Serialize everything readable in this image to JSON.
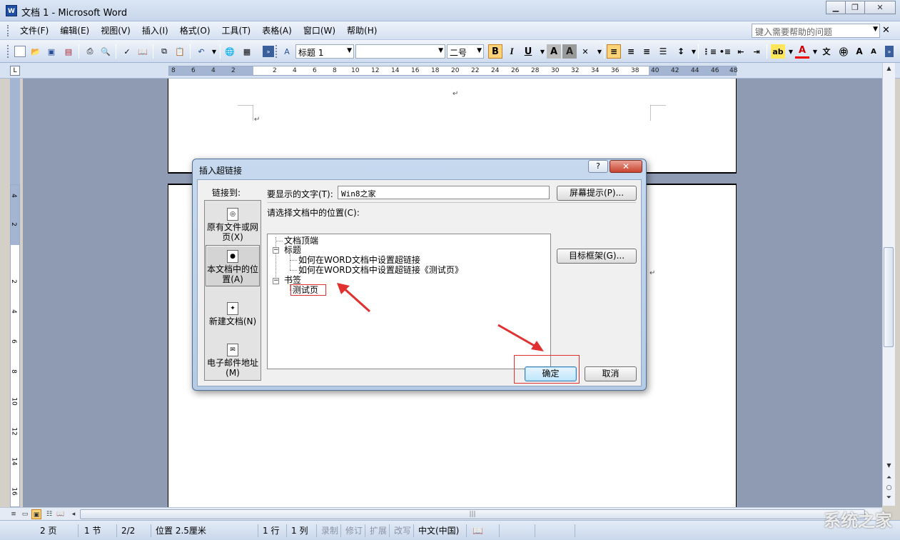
{
  "window": {
    "title": "文档 1 - Microsoft Word",
    "app_icon": "W"
  },
  "menu": {
    "items": [
      "文件(F)",
      "编辑(E)",
      "视图(V)",
      "插入(I)",
      "格式(O)",
      "工具(T)",
      "表格(A)",
      "窗口(W)",
      "帮助(H)"
    ],
    "help_placeholder": "键入需要帮助的问题"
  },
  "toolbar": {
    "style_combo": "标题 1",
    "font_combo": "",
    "size_combo": "二号",
    "bold": "B",
    "italic": "I",
    "underline": "U",
    "char_a": "A",
    "char_a2": "A"
  },
  "ruler": {
    "ticks": [
      "8",
      "6",
      "4",
      "2",
      "",
      "2",
      "4",
      "6",
      "8",
      "10",
      "12",
      "14",
      "16",
      "18",
      "20",
      "22",
      "24",
      "26",
      "28",
      "30",
      "32",
      "34",
      "36",
      "38",
      "40",
      "42",
      "44",
      "46",
      "48"
    ],
    "vticks": [
      "4",
      "2",
      "",
      "2",
      "4",
      "6",
      "8",
      "10",
      "12",
      "14",
      "16"
    ]
  },
  "document": {
    "pilcrow": "↵"
  },
  "dialog": {
    "title": "插入超链接",
    "help_btn": "?",
    "close_btn": "✕",
    "link_to": "链接到:",
    "places": [
      {
        "label": "原有文件或网页(X)",
        "icon": "globe-file-icon"
      },
      {
        "label": "本文档中的位置(A)",
        "icon": "document-place-icon",
        "active": true
      },
      {
        "label": "新建文档(N)",
        "icon": "new-document-icon"
      },
      {
        "label": "电子邮件地址(M)",
        "icon": "email-icon"
      }
    ],
    "display_text_label": "要显示的文字(T):",
    "display_text_value": "Win8之家",
    "screentip_btn": "屏幕提示(P)...",
    "select_place_label": "请选择文档中的位置(C):",
    "tree": {
      "top": "文档顶端",
      "headings": "标题",
      "heading_1": "如何在WORD文档中设置超链接",
      "heading_2": "如何在WORD文档中设置超链接《测试页》",
      "bookmarks": "书签",
      "bookmark_1": "测试页"
    },
    "target_frame_btn": "目标框架(G)...",
    "ok_btn": "确定",
    "cancel_btn": "取消"
  },
  "statusbar": {
    "page": "2 页",
    "section": "1 节",
    "pages": "2/2",
    "position": "位置 2.5厘米",
    "line": "1 行",
    "column": "1 列",
    "rec": "录制",
    "trk": "修订",
    "ext": "扩展",
    "ovr": "改写",
    "language": "中文(中国)"
  },
  "watermark": "系统之家",
  "colors": {
    "accent": "#fbd37a",
    "annotation_red": "#e03030",
    "workspace": "#8f9bb3"
  }
}
